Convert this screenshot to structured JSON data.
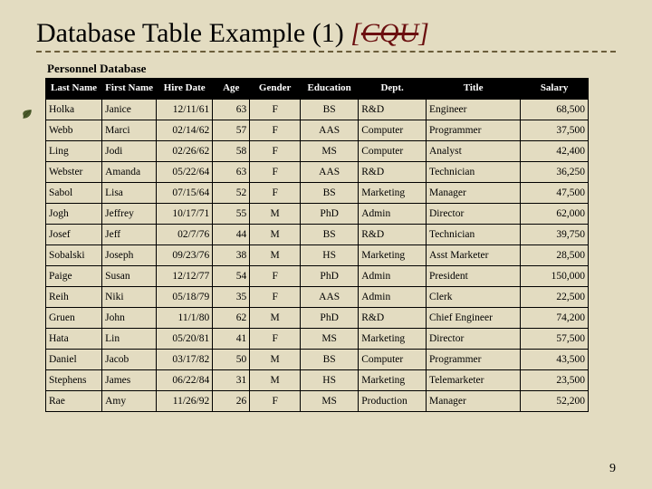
{
  "title_main": "Database Table Example (1) ",
  "title_tag_open": "[",
  "title_tag_text": "CQU",
  "title_tag_close": "]",
  "db_title": "Personnel Database",
  "page_number": "9",
  "headers": {
    "last": "Last Name",
    "first": "First Name",
    "hire": "Hire Date",
    "age": "Age",
    "gender": "Gender",
    "edu": "Education",
    "dept": "Dept.",
    "title": "Title",
    "salary": "Salary"
  },
  "rows": [
    {
      "last": "Holka",
      "first": "Janice",
      "hire": "12/11/61",
      "age": "63",
      "gender": "F",
      "edu": "BS",
      "dept": "R&D",
      "title": "Engineer",
      "salary": "68,500"
    },
    {
      "last": "Webb",
      "first": "Marci",
      "hire": "02/14/62",
      "age": "57",
      "gender": "F",
      "edu": "AAS",
      "dept": "Computer",
      "title": "Programmer",
      "salary": "37,500"
    },
    {
      "last": "Ling",
      "first": "Jodi",
      "hire": "02/26/62",
      "age": "58",
      "gender": "F",
      "edu": "MS",
      "dept": "Computer",
      "title": "Analyst",
      "salary": "42,400"
    },
    {
      "last": "Webster",
      "first": "Amanda",
      "hire": "05/22/64",
      "age": "63",
      "gender": "F",
      "edu": "AAS",
      "dept": "R&D",
      "title": "Technician",
      "salary": "36,250"
    },
    {
      "last": "Sabol",
      "first": "Lisa",
      "hire": "07/15/64",
      "age": "52",
      "gender": "F",
      "edu": "BS",
      "dept": "Marketing",
      "title": "Manager",
      "salary": "47,500"
    },
    {
      "last": "Jogh",
      "first": "Jeffrey",
      "hire": "10/17/71",
      "age": "55",
      "gender": "M",
      "edu": "PhD",
      "dept": "Admin",
      "title": "Director",
      "salary": "62,000"
    },
    {
      "last": "Josef",
      "first": "Jeff",
      "hire": "02/7/76",
      "age": "44",
      "gender": "M",
      "edu": "BS",
      "dept": "R&D",
      "title": "Technician",
      "salary": "39,750"
    },
    {
      "last": "Sobalski",
      "first": "Joseph",
      "hire": "09/23/76",
      "age": "38",
      "gender": "M",
      "edu": "HS",
      "dept": "Marketing",
      "title": "Asst Marketer",
      "salary": "28,500"
    },
    {
      "last": "Paige",
      "first": "Susan",
      "hire": "12/12/77",
      "age": "54",
      "gender": "F",
      "edu": "PhD",
      "dept": "Admin",
      "title": "President",
      "salary": "150,000"
    },
    {
      "last": "Reih",
      "first": "Niki",
      "hire": "05/18/79",
      "age": "35",
      "gender": "F",
      "edu": "AAS",
      "dept": "Admin",
      "title": "Clerk",
      "salary": "22,500"
    },
    {
      "last": "Gruen",
      "first": "John",
      "hire": "11/1/80",
      "age": "62",
      "gender": "M",
      "edu": "PhD",
      "dept": "R&D",
      "title": "Chief Engineer",
      "salary": "74,200"
    },
    {
      "last": "Hata",
      "first": "Lin",
      "hire": "05/20/81",
      "age": "41",
      "gender": "F",
      "edu": "MS",
      "dept": "Marketing",
      "title": "Director",
      "salary": "57,500"
    },
    {
      "last": "Daniel",
      "first": "Jacob",
      "hire": "03/17/82",
      "age": "50",
      "gender": "M",
      "edu": "BS",
      "dept": "Computer",
      "title": "Programmer",
      "salary": "43,500"
    },
    {
      "last": "Stephens",
      "first": "James",
      "hire": "06/22/84",
      "age": "31",
      "gender": "M",
      "edu": "HS",
      "dept": "Marketing",
      "title": "Telemarketer",
      "salary": "23,500"
    },
    {
      "last": "Rae",
      "first": "Amy",
      "hire": "11/26/92",
      "age": "26",
      "gender": "F",
      "edu": "MS",
      "dept": "Production",
      "title": "Manager",
      "salary": "52,200"
    }
  ]
}
